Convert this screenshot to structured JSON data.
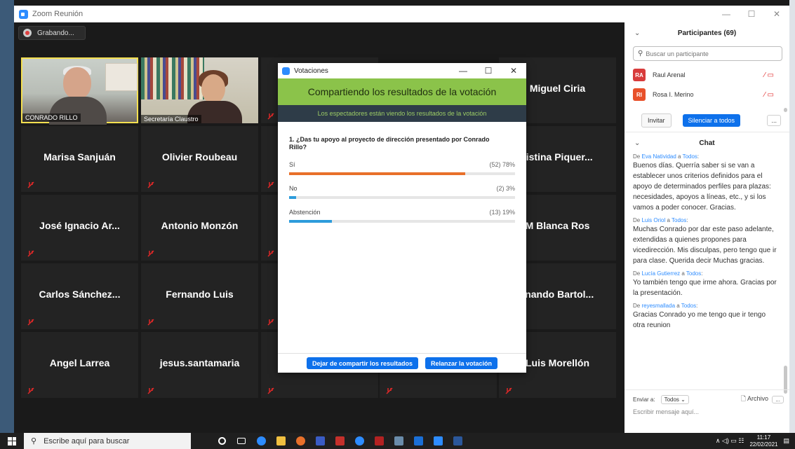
{
  "window": {
    "title": "Zoom Reunión",
    "controls": [
      "—",
      "☐",
      "✕"
    ]
  },
  "recording": {
    "label": "Grabando..."
  },
  "video_tiles": [
    {
      "name": "CONRADO RILLO"
    },
    {
      "name": "Secretaría Claustro"
    }
  ],
  "participant_tiles": {
    "r0c4": "Miguel Ciria",
    "r1c0": "Marisa Sanjuán",
    "r1c1": "Olivier Roubeau",
    "r1c4": "ristina Piquer...",
    "r2c0": "José Ignacio Ar...",
    "r2c1": "Antonio Monzón",
    "r2c4": "M Blanca Ros",
    "r3c0": "Carlos Sánchez...",
    "r3c1": "Fernando Luis",
    "r3c4": "rnando Bartol...",
    "r4c0": "Angel Larrea",
    "r4c1": "jesus.santamaria",
    "r4c4": "Luis Morellón"
  },
  "poll_dialog": {
    "title": "Votaciones",
    "controls": [
      "—",
      "☐",
      "✕"
    ],
    "banner": "Compartiendo los resultados de la votación",
    "subtitle": "Los espectadores están viendo los resultados de la votación",
    "question": "1. ¿Das tu apoyo al proyecto de dirección presentado por Conrado Rillo?",
    "answers": [
      {
        "label": "Sí",
        "result": "(52) 78%",
        "fraction": 0.78,
        "color": "#e8702a"
      },
      {
        "label": "No",
        "result": "(2) 3%",
        "fraction": 0.03,
        "color": "#2d9cdb"
      },
      {
        "label": "Abstención",
        "result": "(13) 19%",
        "fraction": 0.19,
        "color": "#2d9cdb"
      }
    ],
    "buttons": {
      "stop": "Dejar de compartir los resultados",
      "relaunch": "Relanzar la votación"
    }
  },
  "participants_panel": {
    "title": "Participantes (69)",
    "search_placeholder": "Buscar un participante",
    "items": [
      {
        "initials": "RA",
        "name": "Raul Arenal",
        "color": "#d83b3b"
      },
      {
        "initials": "RI",
        "name": "Rosa I. Merino",
        "color": "#e8502a"
      }
    ],
    "invite": "Invitar",
    "mute_all": "Silenciar a todos",
    "more": "..."
  },
  "chat": {
    "title": "Chat",
    "messages": [
      {
        "from": "Eva Natividad",
        "to": "Todos",
        "text": "Buenos días. Querría saber si se van a establecer unos criterios definidos para el apoyo de determinados perfiles para plazas: necesidades, apoyos a líneas, etc., y si los vamos a poder conocer. Gracias."
      },
      {
        "from": "Luis Oriol",
        "to": "Todos",
        "text": "Muchas Conrado por dar este paso adelante, extendidas a quienes propones para vicedirección. Mis disculpas, pero tengo que ir para clase. Querida decir Muchas gracias."
      },
      {
        "from": "Lucía Gutierrez",
        "to": "Todos",
        "text": "Yo también tengo que irme ahora. Gracias por la presentación."
      },
      {
        "from": "reyesmallada",
        "to": "Todos",
        "text": "Gracias Conrado yo me tengo que ir tengo otra reunion"
      }
    ],
    "send_to_label": "Enviar a:",
    "send_to_value": "Todos",
    "file_label": "Archivo",
    "more": "...",
    "input_placeholder": "Escribir mensaje aquí..."
  },
  "taskbar": {
    "search_placeholder": "Escribe aquí para buscar",
    "time": "11:17",
    "date": "22/02/2021"
  }
}
